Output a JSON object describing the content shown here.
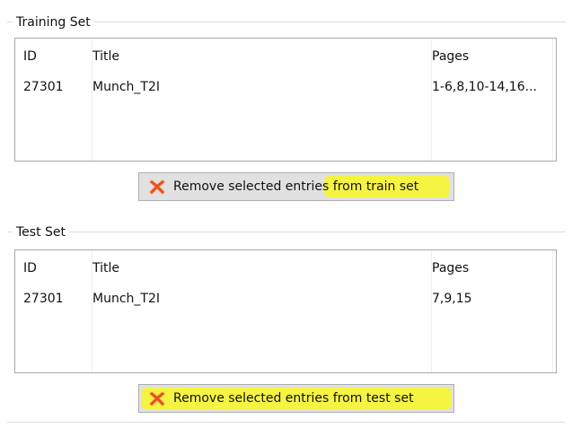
{
  "training_set": {
    "title": "Training Set",
    "columns": {
      "id": "ID",
      "title": "Title",
      "pages": "Pages"
    },
    "rows": [
      {
        "id": "27301",
        "title": "Munch_T2I",
        "pages": "1-6,8,10-14,16..."
      }
    ],
    "remove_button": {
      "label": "Remove selected entries from train set",
      "icon": "red-x-icon",
      "highlight_color": "#f6f43a"
    }
  },
  "test_set": {
    "title": "Test Set",
    "columns": {
      "id": "ID",
      "title": "Title",
      "pages": "Pages"
    },
    "rows": [
      {
        "id": "27301",
        "title": "Munch_T2I",
        "pages": "7,9,15"
      }
    ],
    "remove_button": {
      "label": "Remove selected entries from test set",
      "icon": "red-x-icon",
      "highlight_color": "#f6f43a"
    }
  },
  "colors": {
    "icon_red": "#e8452c",
    "icon_orange": "#f07a2c"
  }
}
